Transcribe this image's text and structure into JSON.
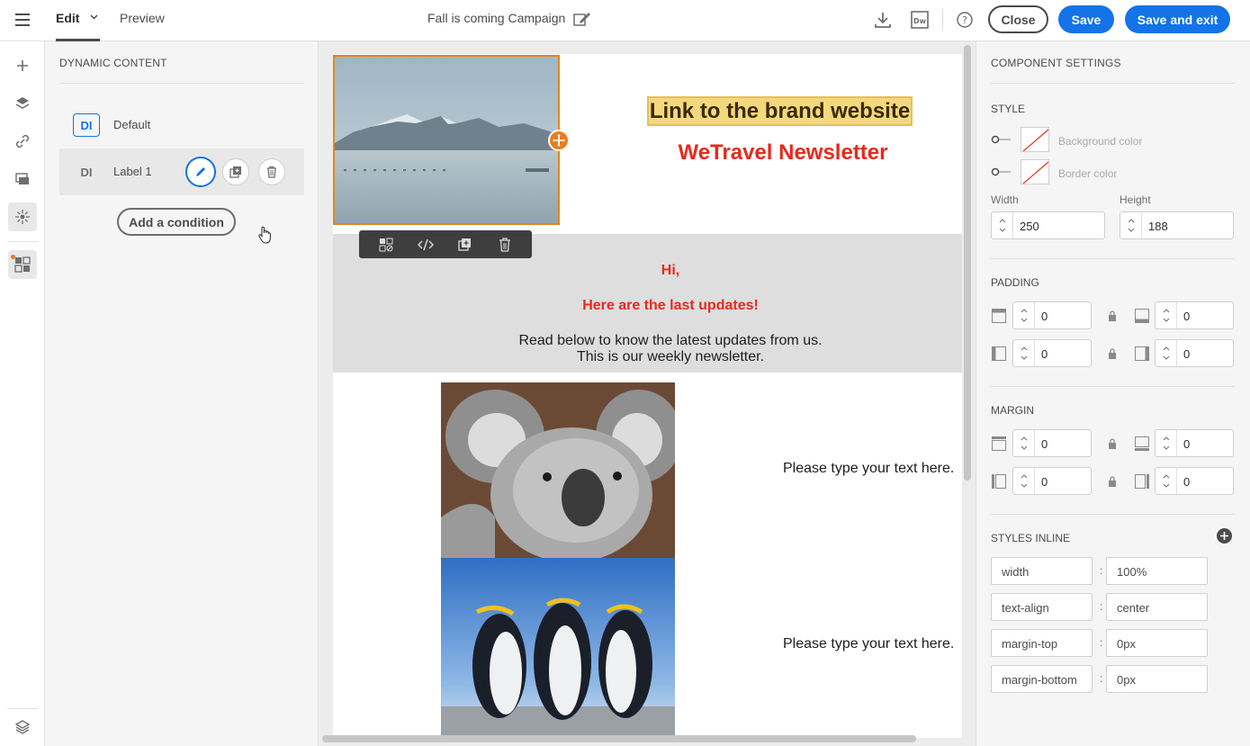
{
  "header": {
    "edit_tab": "Edit",
    "preview_tab": "Preview",
    "campaign_title": "Fall is coming Campaign",
    "close_label": "Close",
    "save_label": "Save",
    "save_exit_label": "Save and exit"
  },
  "dynamic_content": {
    "heading": "DYNAMIC CONTENT",
    "items": [
      {
        "badge": "DI",
        "label": "Default"
      },
      {
        "badge": "DI",
        "label": "Label 1"
      }
    ],
    "add_condition_label": "Add a condition"
  },
  "email": {
    "brand_link": "Link to the brand website",
    "newsletter_title": "WeTravel Newsletter",
    "greeting": "Hi,",
    "subheading": "Here are the last updates!",
    "body_line1": "Read below to know the latest updates from us.",
    "body_line2": "This is our weekly newsletter.",
    "placeholder_1": "Please type your text here.",
    "placeholder_2": "Please type your text here."
  },
  "settings": {
    "heading": "COMPONENT SETTINGS",
    "style_heading": "STYLE",
    "background_color_label": "Background color",
    "border_color_label": "Border color",
    "width_label": "Width",
    "width_value": "250",
    "height_label": "Height",
    "height_value": "188",
    "padding_heading": "PADDING",
    "padding": {
      "top": "0",
      "bottom": "0",
      "left": "0",
      "right": "0"
    },
    "margin_heading": "MARGIN",
    "margin": {
      "top": "0",
      "bottom": "0",
      "left": "0",
      "right": "0"
    },
    "styles_inline_heading": "STYLES INLINE",
    "inline_styles": [
      {
        "property": "width",
        "value": "100%"
      },
      {
        "property": "text-align",
        "value": "center"
      },
      {
        "property": "margin-top",
        "value": "0px"
      },
      {
        "property": "margin-bottom",
        "value": "0px"
      }
    ]
  },
  "colors": {
    "accent_blue": "#1473e6",
    "selection_orange": "#e68619",
    "headline_red": "#e8291c",
    "brand_link_bg": "#f4d87d"
  }
}
